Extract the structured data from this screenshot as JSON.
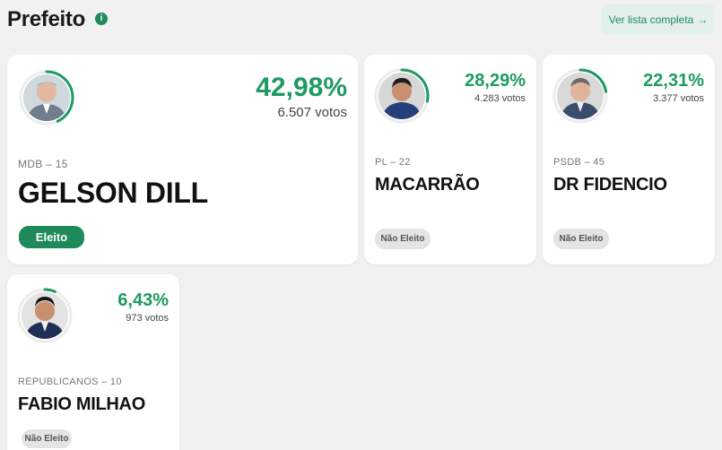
{
  "header": {
    "title": "Prefeito",
    "info_icon": "info-icon",
    "full_list_label": "Ver lista completa",
    "full_list_arrow": "→"
  },
  "colors": {
    "accent": "#1e9a62",
    "elected_badge": "#1e8a5a",
    "not_elected_badge": "#e4e4e4"
  },
  "candidates": [
    {
      "name": "GELSON DILL",
      "party": "MDB – 15",
      "percent": "42,98%",
      "percent_value": 42.98,
      "votes": "6.507 votos",
      "status": "Eleito"
    },
    {
      "name": "MACARRÃO",
      "party": "PL – 22",
      "percent": "28,29%",
      "percent_value": 28.29,
      "votes": "4.283 votos",
      "status": "Não Eleito"
    },
    {
      "name": "DR FIDENCIO",
      "party": "PSDB – 45",
      "percent": "22,31%",
      "percent_value": 22.31,
      "votes": "3.377 votos",
      "status": "Não Eleito"
    },
    {
      "name": "FABIO MILHAO",
      "party": "REPUBLICANOS – 10",
      "percent": "6,43%",
      "percent_value": 6.43,
      "votes": "973 votos",
      "status": "Não Eleito"
    }
  ]
}
